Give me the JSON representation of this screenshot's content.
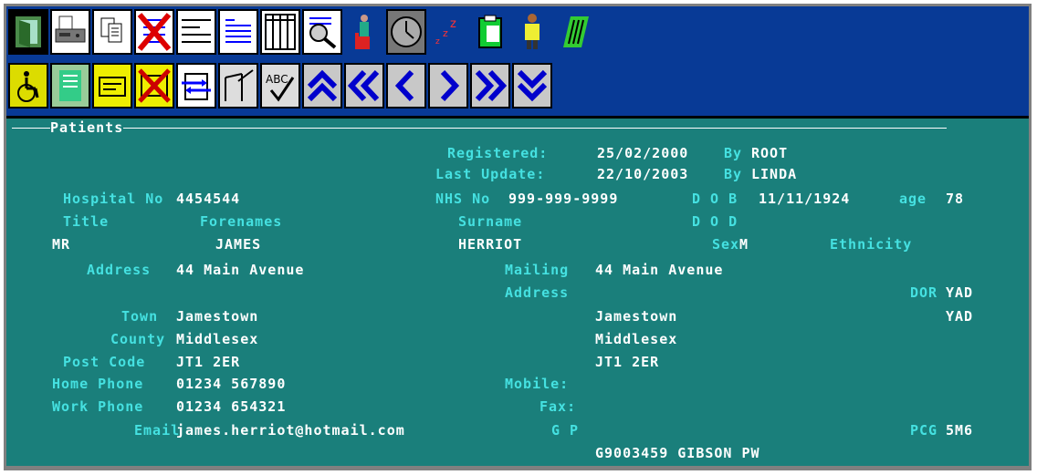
{
  "toolbar": {
    "row1": [
      "exit-icon",
      "fax-icon",
      "copy-document-icon",
      "delete-list-icon",
      "text-list-icon",
      "lines-text-icon",
      "columns-icon",
      "search-document-icon",
      "person-chair-icon",
      "clock-icon",
      "sleep-icon",
      "clipboard-icon",
      "person-yellow-icon",
      "barcode-icon"
    ],
    "row2": [
      "wheelchair-icon",
      "notes-green-icon",
      "message-yellow-icon",
      "delete-message-icon",
      "transfer-icon",
      "graph-icon",
      "spellcheck-icon",
      "first-record-icon",
      "previous-page-icon",
      "previous-record-icon",
      "next-record-icon",
      "next-page-icon",
      "last-record-icon"
    ],
    "spellcheck_text": "ABC"
  },
  "section_title": "Patients",
  "labels": {
    "registered": "Registered:",
    "by1": "By",
    "last_update": "Last Update:",
    "by2": "By",
    "hospital_no": "Hospital No",
    "nhs_no": "NHS No",
    "dob": "D O B",
    "age": "age",
    "title": "Title",
    "forenames": "Forenames",
    "surname": "Surname",
    "dod": "D O D",
    "sex": "Sex",
    "ethnicity": "Ethnicity",
    "address": "Address",
    "mailing": "Mailing",
    "mailing_address": "Address",
    "dor": "DOR",
    "town": "Town",
    "county": "County",
    "post_code": "Post Code",
    "home_phone": "Home Phone",
    "mobile": "Mobile:",
    "work_phone": "Work Phone",
    "fax": "Fax:",
    "email": "Email",
    "gp": "G P",
    "pcg": "PCG"
  },
  "values": {
    "registered_date": "25/02/2000",
    "registered_by": "ROOT",
    "last_update_date": "22/10/2003",
    "last_update_by": "LINDA",
    "hospital_no": "4454544",
    "nhs_no": "999-999-9999",
    "dob": "11/11/1924",
    "age": "78",
    "title": "MR",
    "forenames": "JAMES",
    "surname": "HERRIOT",
    "sex": "M",
    "address": "44 Main Avenue",
    "mailing_line1": "44 Main Avenue",
    "dor1": "YAD",
    "town": "Jamestown",
    "mailing_town": "Jamestown",
    "dor2": "YAD",
    "county": "Middlesex",
    "mailing_county": "Middlesex",
    "post_code": "JT1 2ER",
    "mailing_post_code": "JT1 2ER",
    "home_phone": "01234 567890",
    "work_phone": "01234 654321",
    "email": "james.herriot@hotmail.com",
    "pcg": "5M6",
    "gp": "G9003459 GIBSON PW"
  }
}
